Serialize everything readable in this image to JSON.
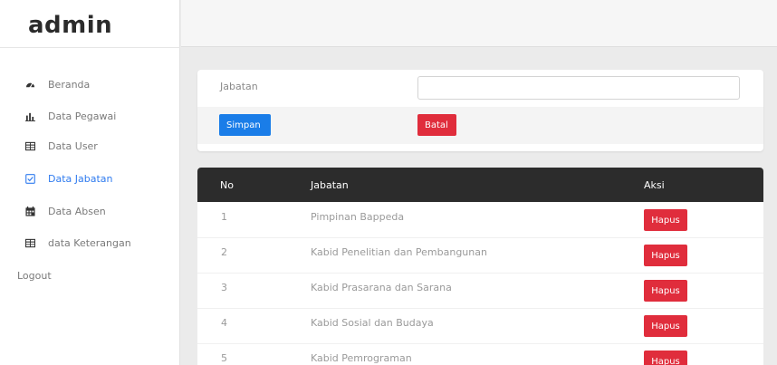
{
  "brand": "admin",
  "sidebar": {
    "items": [
      {
        "label": "Beranda",
        "icon": "dashboard-icon"
      },
      {
        "label": "Data Pegawai",
        "icon": "bar-chart-icon"
      },
      {
        "label": "Data User",
        "icon": "table-icon"
      },
      {
        "label": "Data Jabatan",
        "icon": "checkbox-icon",
        "active": true
      },
      {
        "label": "Data Absen",
        "icon": "calendar-icon"
      },
      {
        "label": "data Keterangan",
        "icon": "table-icon"
      }
    ],
    "logout": "Logout"
  },
  "form": {
    "label": "Jabatan",
    "value": "",
    "save_label": "Simpan",
    "cancel_label": "Batal"
  },
  "table": {
    "headers": [
      "No",
      "Jabatan",
      "Aksi"
    ],
    "rows": [
      {
        "no": "1",
        "jabatan": "Pimpinan Bappeda",
        "action": "Hapus"
      },
      {
        "no": "2",
        "jabatan": "Kabid Penelitian dan Pembangunan",
        "action": "Hapus"
      },
      {
        "no": "3",
        "jabatan": "Kabid Prasarana dan Sarana",
        "action": "Hapus"
      },
      {
        "no": "4",
        "jabatan": "Kabid Sosial dan Budaya",
        "action": "Hapus"
      },
      {
        "no": "5",
        "jabatan": "Kabid Pemrograman",
        "action": "Hapus"
      }
    ]
  },
  "colors": {
    "accent": "#2f7bef",
    "primary_button": "#1a7de8",
    "danger_button": "#e02d3c",
    "table_header": "#2c2c2c"
  }
}
